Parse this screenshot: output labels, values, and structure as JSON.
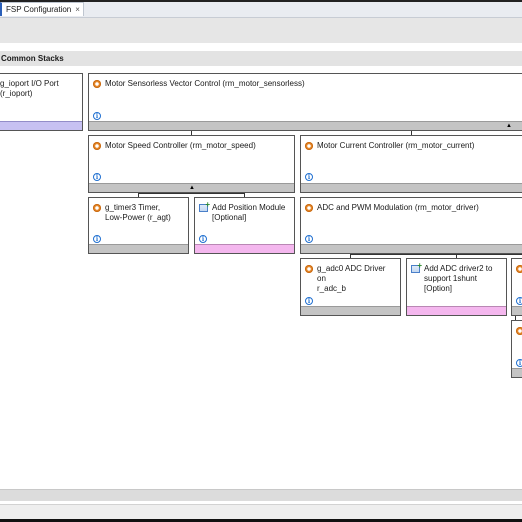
{
  "editor_tab": {
    "label": "FSP Configuration",
    "close_glyph": "×"
  },
  "section": {
    "title": "Common Stacks"
  },
  "modules": {
    "ioport": {
      "title": "g_ioport I/O Port\n(r_ioport)",
      "icon": "gear-icon",
      "bar_color": "#c7c1f2"
    },
    "sensorless": {
      "title": "Motor Sensorless Vector Control (rm_motor_sensorless)",
      "icon": "gear-icon"
    },
    "speed": {
      "title": "Motor Speed Controller (rm_motor_speed)",
      "icon": "gear-icon"
    },
    "current": {
      "title": "Motor Current Controller (rm_motor_current)",
      "icon": "gear-icon"
    },
    "timer": {
      "title": "g_timer3 Timer,\nLow-Power (r_agt)",
      "icon": "gear-icon"
    },
    "position": {
      "title": "Add Position Module\n[Optional]",
      "icon": "add-module-icon",
      "bar_color": "#f4b7ee"
    },
    "adc_pwm": {
      "title": "ADC and PWM Modulation (rm_motor_driver)",
      "icon": "gear-icon"
    },
    "adc0": {
      "title": "g_adc0 ADC Driver on\nr_adc_b",
      "icon": "gear-icon"
    },
    "adc2": {
      "title": "Add ADC driver2 to\nsupport 1shunt\n[Option]",
      "icon": "add-module-icon",
      "bar_color": "#f4b7ee"
    }
  },
  "glyphs": {
    "info": "i",
    "collapse": "▲"
  }
}
